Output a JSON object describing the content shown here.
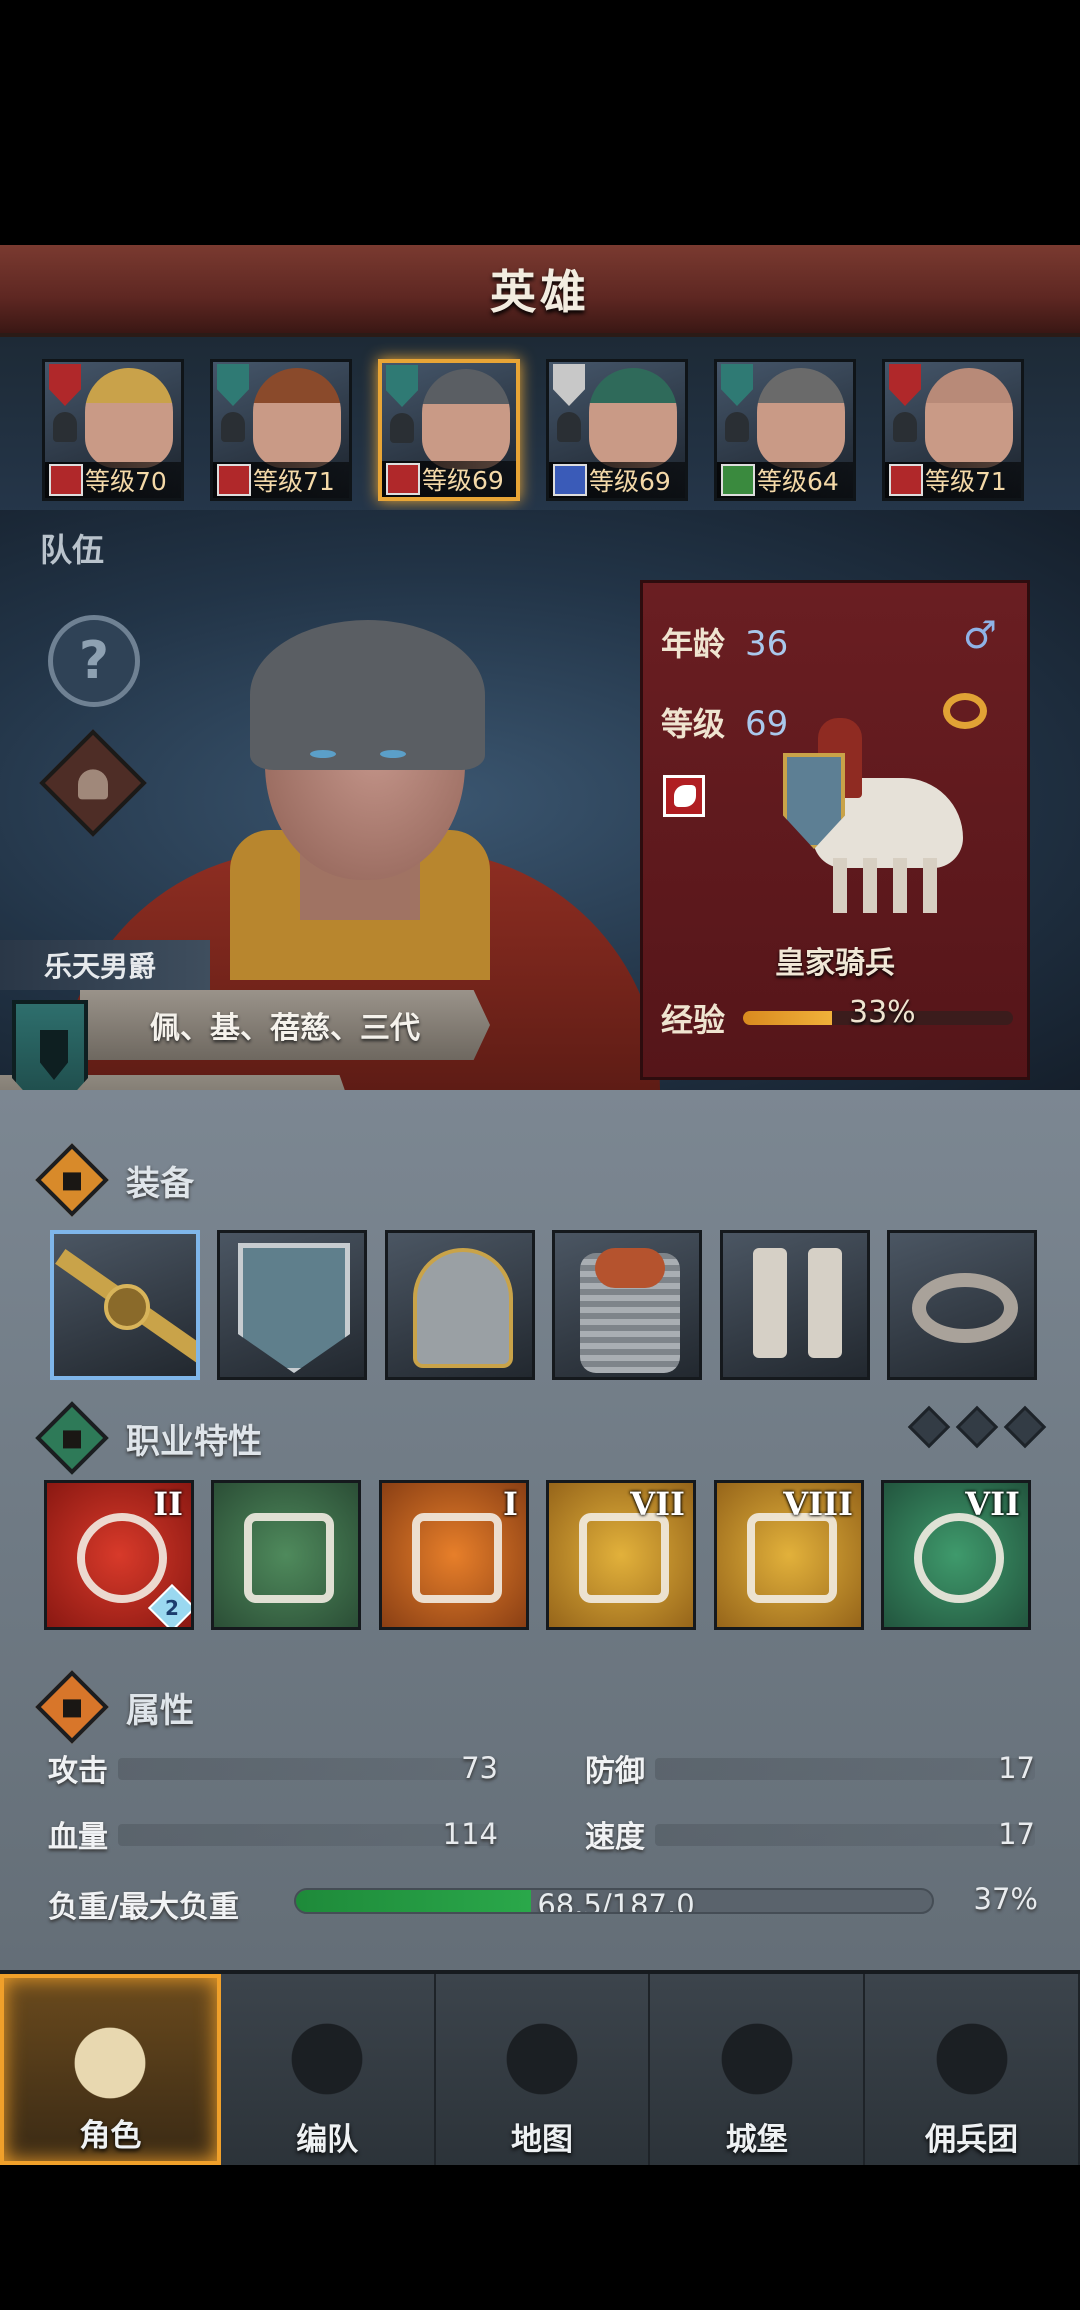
{
  "header": {
    "title": "英雄"
  },
  "roster": [
    {
      "level_label": "等级70",
      "shield_color": "#b0282a",
      "class_color": "#b0282a",
      "hair": "#c9a24a"
    },
    {
      "level_label": "等级71",
      "shield_color": "#2f7a74",
      "class_color": "#b0282a",
      "hair": "#8a4a2b"
    },
    {
      "level_label": "等级69",
      "shield_color": "#2f7a74",
      "class_color": "#b0282a",
      "hair": "#5a5e63",
      "selected": true
    },
    {
      "level_label": "等级69",
      "shield_color": "#c8c8c8",
      "class_color": "#3a5bb8",
      "hair": "#2f6a5a"
    },
    {
      "level_label": "等级64",
      "shield_color": "#2f7a74",
      "class_color": "#3a8a3e",
      "hair": "#6a6a6a"
    },
    {
      "level_label": "等级71",
      "shield_color": "#b0282a",
      "class_color": "#b0282a",
      "hair": "#b88a78"
    }
  ],
  "team_label": "队伍",
  "hero": {
    "title_name": "乐天男爵",
    "lineage": "佩、基、蓓慈、三代",
    "short_name": "佩",
    "help_icon": "question-icon",
    "info": {
      "age_label": "年龄",
      "age": "36",
      "gender_icon": "male-icon",
      "gender_symbol": "♂",
      "level_label": "等级",
      "level": "69",
      "unit_name": "皇家骑兵",
      "exp_label": "经验",
      "exp_percent_text": "33%",
      "exp_fraction": 0.33
    }
  },
  "equipment": {
    "title": "装备",
    "items": [
      {
        "name": "sword",
        "selected": true
      },
      {
        "name": "shield"
      },
      {
        "name": "helmet"
      },
      {
        "name": "armor"
      },
      {
        "name": "boots"
      },
      {
        "name": "ring"
      }
    ]
  },
  "traits": {
    "title": "职业特性",
    "pips": 3,
    "items": [
      {
        "name": "charge-target",
        "color": "red",
        "rank": "II",
        "sub_badge": "2"
      },
      {
        "name": "horse-speed",
        "color": "green",
        "rank": ""
      },
      {
        "name": "sword-up",
        "color": "orange",
        "rank": "I"
      },
      {
        "name": "shield-break",
        "color": "gold",
        "rank": "VII"
      },
      {
        "name": "shield-break-2",
        "color": "gold",
        "rank": "VIII"
      },
      {
        "name": "crosshair",
        "color": "teal",
        "rank": "VII"
      }
    ]
  },
  "attributes": {
    "title": "属性",
    "attack_label": "攻击",
    "attack": "73",
    "defense_label": "防御",
    "defense": "17",
    "hp_label": "血量",
    "hp": "114",
    "speed_label": "速度",
    "speed": "17",
    "load_label": "负重/最大负重",
    "load_text": "68.5/187.0",
    "load_percent_text": "37%",
    "load_fraction": 0.37
  },
  "nav": [
    {
      "label": "角色",
      "icon": "knight-icon",
      "active": true
    },
    {
      "label": "编队",
      "icon": "helmet-icon"
    },
    {
      "label": "地图",
      "icon": "compass-icon"
    },
    {
      "label": "城堡",
      "icon": "castle-icon"
    },
    {
      "label": "佣兵团",
      "icon": "mercenary-icon"
    }
  ]
}
